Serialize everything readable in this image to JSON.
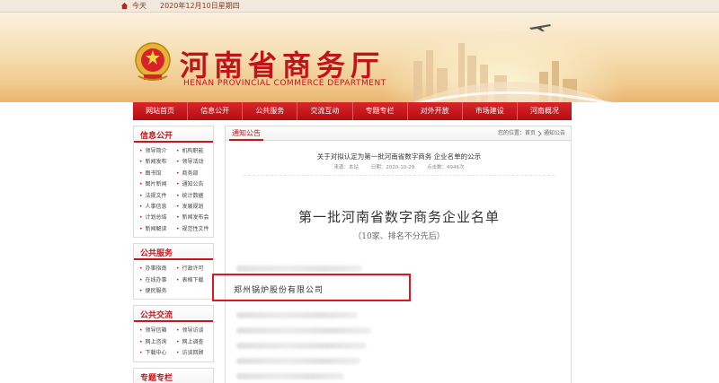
{
  "topbar": {
    "today_label": "今天",
    "date": "2020年12月10日星期四"
  },
  "header": {
    "title_cn": "河南省商务厅",
    "title_en": "HENAN PROVINCIAL COMMERCE DEPARTMENT",
    "brand_color": "#c1141a"
  },
  "nav": [
    "网站首页",
    "信息公开",
    "公共服务",
    "交流互动",
    "专题专栏",
    "对外开放",
    "市场建设",
    "河南概况"
  ],
  "sidebar": {
    "info": {
      "title": "信息公开",
      "items": [
        "领导简介",
        "机构职能",
        "新闻发布",
        "领导活动",
        "图书馆",
        "商务部",
        "图片新闻",
        "通知公告",
        "法规文件",
        "统计数据",
        "人事信息",
        "发展规划",
        "计划总结",
        "新闻发布会",
        "新闻解读",
        "规范性文件"
      ]
    },
    "service": {
      "title": "公共服务",
      "items": [
        "办事指南",
        "行政许可",
        "在线办事",
        "表格下载",
        "便民服务"
      ]
    },
    "interact": {
      "title": "公共交流",
      "items": [
        "领导信箱",
        "领导访谈",
        "网上咨询",
        "网上调查",
        "下载中心",
        "访谈回顾"
      ]
    },
    "special": {
      "title": "专题专栏"
    }
  },
  "main": {
    "tab": "通知公告",
    "breadcrumb_prefix": "您的位置：",
    "breadcrumb_home": "首页",
    "breadcrumb_current": "通知公告",
    "article_title": "关于对拟认定为第一批河南省数字商务 企业名单的公示",
    "meta_source": "来源：本站",
    "meta_date": "日期：2020-10-29",
    "meta_clicks": "点击数：4946次",
    "doc_title": "第一批河南省数字商务企业名单",
    "doc_subtitle": "（10家、排名不分先后）",
    "highlighted_company": "郑州锅炉股份有限公司"
  },
  "colors": {
    "nav_red": "#c8161d",
    "highlight_red": "#e1161d"
  }
}
